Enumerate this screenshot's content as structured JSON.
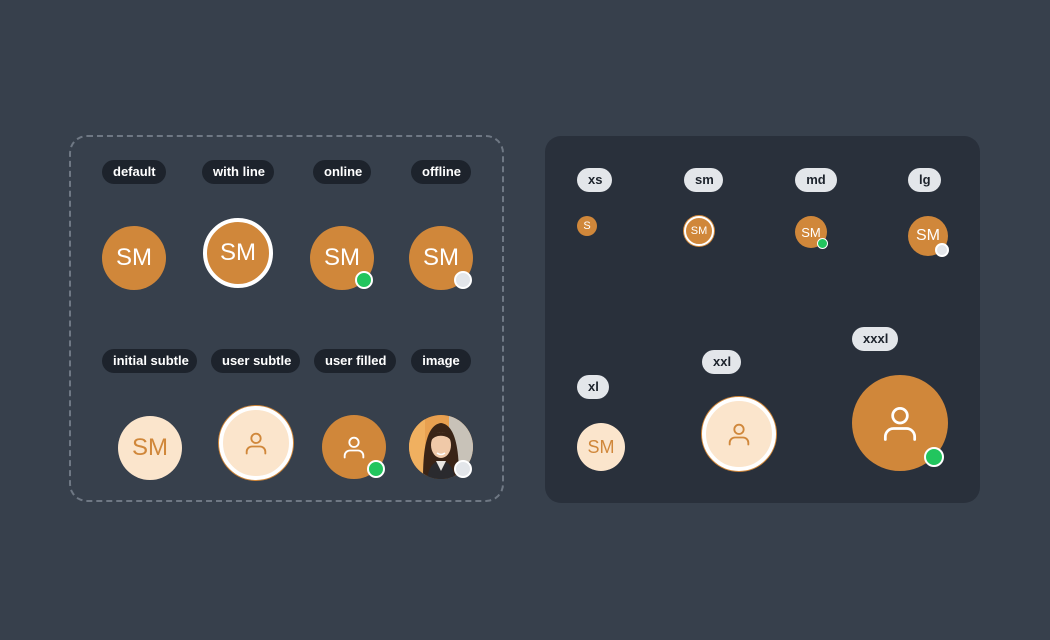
{
  "colors": {
    "background": "#37404c",
    "panel_dark": "#29303b",
    "avatar_orange": "#d0873a",
    "avatar_subtle": "#fbe5cc",
    "online_green": "#22c55e",
    "offline_gray": "#e3e6ea"
  },
  "variants": {
    "labels": {
      "default": "default",
      "with_line": "with line",
      "online": "online",
      "offline": "offline",
      "initial_subtle": "initial subtle",
      "user_subtle": "user subtle",
      "user_filled": "user filled",
      "image": "image"
    },
    "initials": "SM",
    "icons": {
      "user": "user-icon",
      "photo": "profile-photo"
    }
  },
  "sizes": {
    "labels": {
      "xs": "xs",
      "sm": "sm",
      "md": "md",
      "lg": "lg",
      "xl": "xl",
      "xxl": "xxl",
      "xxxl": "xxxl"
    },
    "xs_initial": "S",
    "initials": "SM"
  }
}
